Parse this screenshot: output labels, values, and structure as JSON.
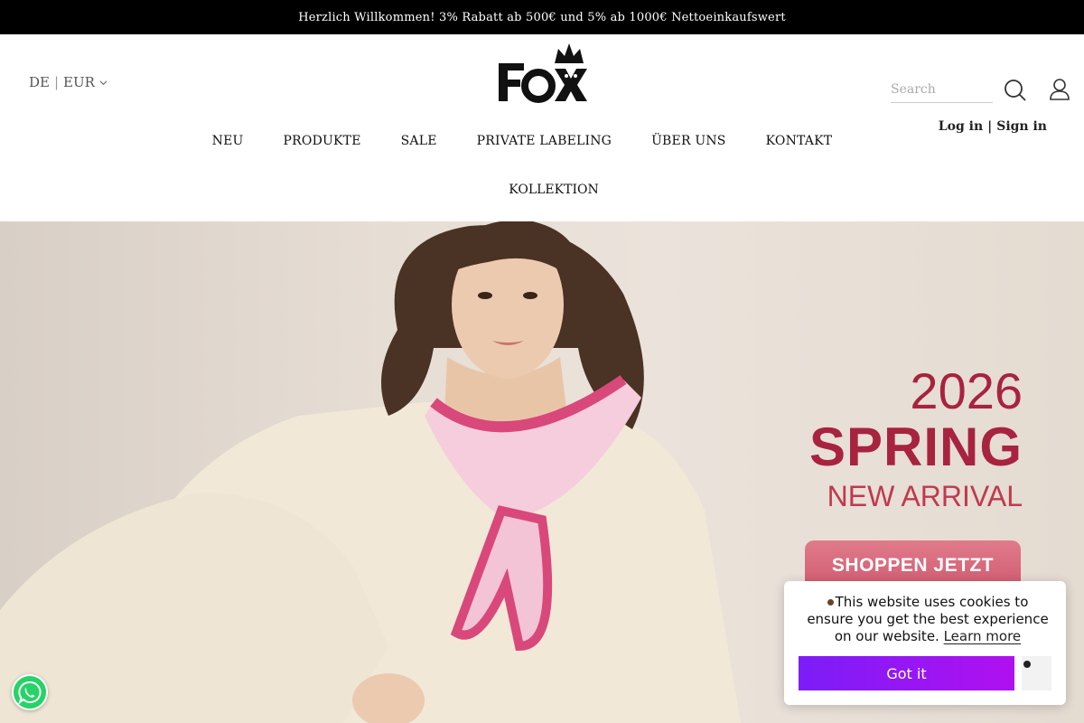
{
  "announcement": "Herzlich Willkommen! 3% Rabatt ab 500€ und 5% ab 1000€ Nettoeinkaufswert",
  "header": {
    "language": "DE",
    "separator": "|",
    "currency": "EUR",
    "logo_text": "Fox",
    "search_placeholder": "Search",
    "login": "Log in",
    "auth_separator": "|",
    "signin": "Sign in"
  },
  "nav": {
    "items": [
      "NEU",
      "PRODUKTE",
      "SALE",
      "PRIVATE LABELING",
      "ÜBER UNS",
      "KONTAKT"
    ],
    "second_row": "KOLLEKTION"
  },
  "hero": {
    "year": "2026",
    "season": "SPRING",
    "subtitle": "NEW ARRIVAL",
    "cta": "SHOPPEN JETZT",
    "text_color": "#a8233f"
  },
  "cookie": {
    "message": "This website uses cookies to ensure you get the best experience on our website.",
    "link": "Learn more",
    "button": "Got it"
  },
  "colors": {
    "announce_bg": "#000000",
    "cta_bg": "#d9697c",
    "cookie_button": "#8f17f5",
    "whatsapp": "#25d366"
  }
}
